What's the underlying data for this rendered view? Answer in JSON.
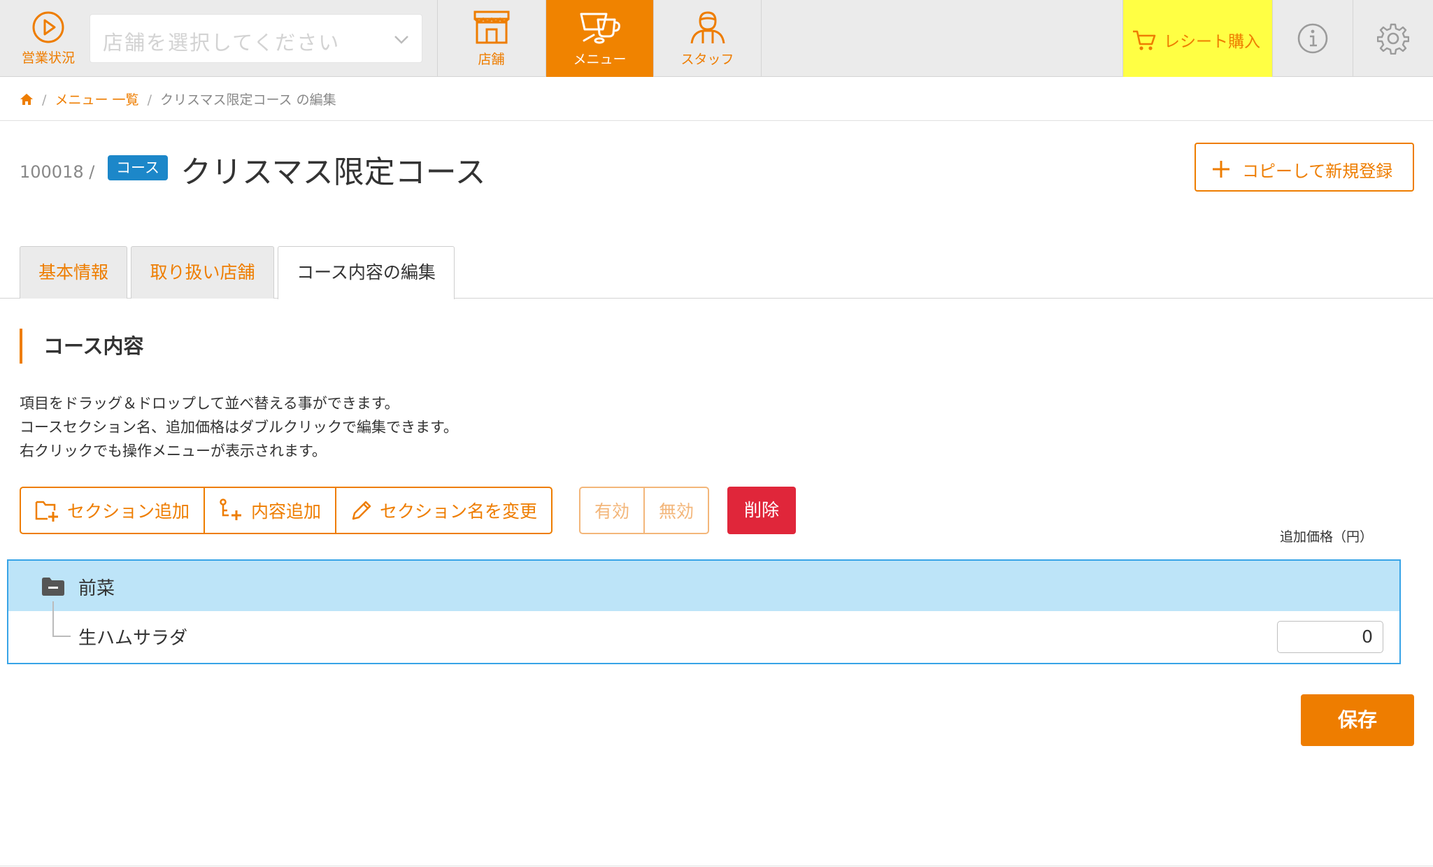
{
  "topbar": {
    "status_label": "営業状況",
    "store_select_placeholder": "店舗を選択してください",
    "nav": [
      {
        "label": "店舗",
        "icon": "store-icon"
      },
      {
        "label": "メニュー",
        "icon": "cup-icon"
      },
      {
        "label": "スタッフ",
        "icon": "staff-icon"
      }
    ],
    "receipt_label": "レシート購入",
    "accent": "#ee7d00",
    "active_nav_bg": "#f08300",
    "receipt_bg": "#ffff44"
  },
  "breadcrumb": {
    "home_icon": "home-icon",
    "menu_list": "メニュー 一覧",
    "current": "クリスマス限定コース の編集"
  },
  "header": {
    "id": "100018 /",
    "badge": "コース",
    "title": "クリスマス限定コース",
    "copy_button": "コピーして新規登録"
  },
  "tabs": [
    {
      "label": "基本情報"
    },
    {
      "label": "取り扱い店舗"
    },
    {
      "label": "コース内容の編集"
    }
  ],
  "section": {
    "heading": "コース内容",
    "help_lines": [
      "項目をドラッグ＆ドロップして並べ替える事ができます。",
      "コースセクション名、追加価格はダブルクリックで編集できます。",
      "右クリックでも操作メニューが表示されます。"
    ]
  },
  "toolbar": {
    "add_section": "セクション追加",
    "add_content": "内容追加",
    "rename_section": "セクション名を変更",
    "enable": "有効",
    "disable": "無効",
    "delete": "削除",
    "price_header": "追加価格（円）"
  },
  "tree": {
    "section_name": "前菜",
    "items": [
      {
        "name": "生ハムサラダ",
        "price": "0"
      }
    ]
  },
  "save_label": "保存"
}
